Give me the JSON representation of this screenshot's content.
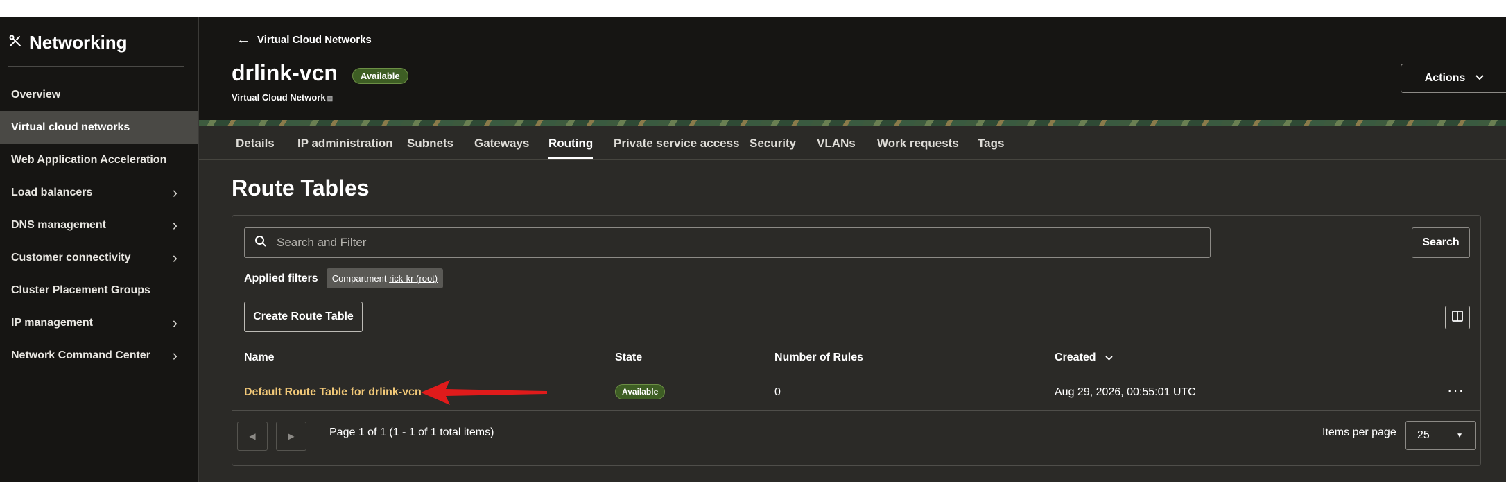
{
  "sidebar": {
    "title": "Networking",
    "items": [
      {
        "label": "Overview",
        "has_submenu": false,
        "active": false
      },
      {
        "label": "Virtual cloud networks",
        "has_submenu": false,
        "active": true
      },
      {
        "label": "Web Application Acceleration",
        "has_submenu": false,
        "active": false
      },
      {
        "label": "Load balancers",
        "has_submenu": true,
        "active": false
      },
      {
        "label": "DNS management",
        "has_submenu": true,
        "active": false
      },
      {
        "label": "Customer connectivity",
        "has_submenu": true,
        "active": false
      },
      {
        "label": "Cluster Placement Groups",
        "has_submenu": false,
        "active": false
      },
      {
        "label": "IP management",
        "has_submenu": true,
        "active": false
      },
      {
        "label": "Network Command Center",
        "has_submenu": true,
        "active": false
      }
    ]
  },
  "header": {
    "back_label": "Virtual Cloud Networks",
    "vcn_name": "drlink-vcn",
    "status": "Available",
    "type_label": "Virtual Cloud Network",
    "actions_label": "Actions"
  },
  "tabs": [
    {
      "label": "Details"
    },
    {
      "label": "IP administration"
    },
    {
      "label": "Subnets"
    },
    {
      "label": "Gateways"
    },
    {
      "label": "Routing",
      "active": true
    },
    {
      "label": "Private service access"
    },
    {
      "label": "Security"
    },
    {
      "label": "VLANs"
    },
    {
      "label": "Work requests"
    },
    {
      "label": "Tags"
    }
  ],
  "page_title": "Route Tables",
  "search": {
    "placeholder": "Search and Filter",
    "button_label": "Search"
  },
  "filters": {
    "label": "Applied filters",
    "chip_prefix": "Compartment",
    "chip_value": "rick-kr (root)"
  },
  "create_label": "Create Route Table",
  "table": {
    "columns": [
      "Name",
      "State",
      "Number of Rules",
      "Created"
    ],
    "rows": [
      {
        "name": "Default Route Table for drlink-vcn",
        "state": "Available",
        "rules": "0",
        "created": "Aug 29, 2026, 00:55:01 UTC"
      }
    ]
  },
  "pagination": {
    "text": "Page 1 of 1 (1 - 1 of 1 total items)",
    "items_per_page_label": "Items per page",
    "items_per_page": "25"
  },
  "colors": {
    "accent_link": "#f1c878",
    "status_green": "#3e5e24",
    "annotation_arrow": "#e01b1b"
  },
  "icons": [
    "networking-icon",
    "back-arrow-icon",
    "chevron-right-icon",
    "chevron-down-icon",
    "search-icon",
    "columns-icon",
    "kebab-icon",
    "prev-page-icon",
    "next-page-icon",
    "caret-down-icon",
    "annotation-arrow"
  ]
}
